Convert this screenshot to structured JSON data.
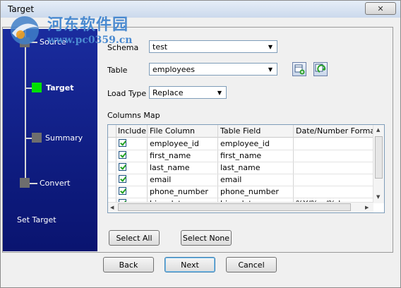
{
  "window": {
    "title": "Target",
    "close_label": "✕"
  },
  "watermark": {
    "line1": "河东软件园",
    "line2": "www.pc0359.cn"
  },
  "steps": [
    {
      "label": "Source",
      "state": "inactive"
    },
    {
      "label": "Target",
      "state": "active"
    },
    {
      "label": "Summary",
      "state": "inactive"
    },
    {
      "label": "Convert",
      "state": "inactive"
    }
  ],
  "sidebar_footer": "Set Target",
  "form": {
    "schema_label": "Schema",
    "schema_value": "test",
    "table_label": "Table",
    "table_value": "employees",
    "loadtype_label": "Load Type",
    "loadtype_value": "Replace",
    "columns_map_label": "Columns Map"
  },
  "grid": {
    "columns": [
      "Include",
      "File Column",
      "Table Field",
      "Date/Number Format"
    ],
    "rows": [
      {
        "include": true,
        "file_column": "employee_id",
        "table_field": "employee_id",
        "format": ""
      },
      {
        "include": true,
        "file_column": "first_name",
        "table_field": "first_name",
        "format": ""
      },
      {
        "include": true,
        "file_column": "last_name",
        "table_field": "last_name",
        "format": ""
      },
      {
        "include": true,
        "file_column": "email",
        "table_field": "email",
        "format": ""
      },
      {
        "include": true,
        "file_column": "phone_number",
        "table_field": "phone_number",
        "format": ""
      },
      {
        "include": true,
        "file_column": "hire_date",
        "table_field": "hire_date",
        "format": "%Y/%m/%d"
      }
    ]
  },
  "buttons": {
    "select_all": "Select All",
    "select_none": "Select None",
    "back": "Back",
    "next": "Next",
    "cancel": "Cancel"
  },
  "colors": {
    "sidebar": "#0d1a7c",
    "active_step": "#00e000",
    "inactive_step": "#6e6e6e"
  }
}
